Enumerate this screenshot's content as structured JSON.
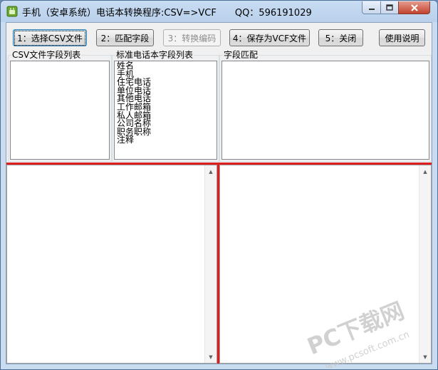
{
  "window": {
    "title": "手机（安卓系统）电话本转换程序:CSV=>VCF",
    "qq": "QQ：596191029"
  },
  "toolbar": {
    "btn1": "1：选择CSV文件",
    "btn2": "2：匹配字段",
    "btn3": "3：转换编码",
    "btn4": "4：保存为VCF文件",
    "btn5": "5：关闭",
    "btn6": "使用说明"
  },
  "groups": {
    "csv_fields": "CSV文件字段列表",
    "std_fields": "标准电话本字段列表",
    "field_match": "字段匹配"
  },
  "std_field_items": [
    "姓名",
    "手机",
    "住宅电话",
    "单位电话",
    "其他电话",
    "工作邮箱",
    "私人邮箱",
    "公司名称",
    "职务职称",
    "注释"
  ],
  "watermark": {
    "brand": "PC下载网",
    "url": "www.pcsoft.com.cn"
  },
  "colors": {
    "separator": "#dc1e1e",
    "title_gradient": "#b9d1ec",
    "close_button": "#c2432e"
  }
}
